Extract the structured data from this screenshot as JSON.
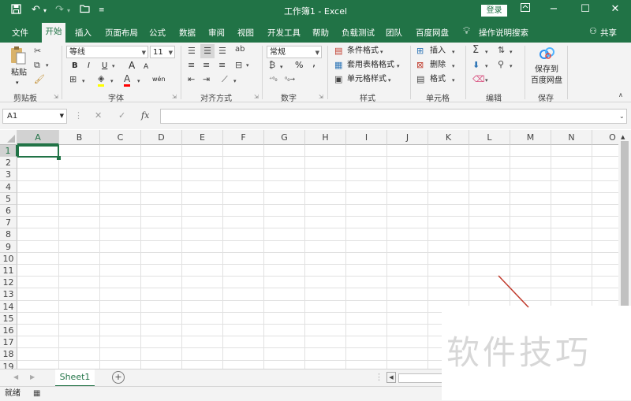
{
  "title_bar": {
    "title": "工作簿1 - Excel",
    "login_label": "登录",
    "quick_access": [
      "save-icon",
      "undo-icon",
      "redo-icon",
      "open-icon",
      "customize-icon"
    ],
    "window_controls": [
      "ribbon-display-icon",
      "minimize-icon",
      "maximize-icon",
      "close-icon"
    ]
  },
  "tabs": [
    "文件",
    "开始",
    "插入",
    "页面布局",
    "公式",
    "数据",
    "审阅",
    "视图",
    "开发工具",
    "帮助",
    "负载测试",
    "团队",
    "百度网盘"
  ],
  "tell_me": "操作说明搜索",
  "share": "共享",
  "ribbon": {
    "clipboard": {
      "paste_label": "粘贴",
      "group_label": "剪贴板"
    },
    "font": {
      "font_name": "等线",
      "font_size": "11",
      "group_label": "字体",
      "bold": "B",
      "italic": "I",
      "underline": "U",
      "phonetic": "wén",
      "grow": "A",
      "shrink": "A"
    },
    "alignment": {
      "group_label": "对齐方式"
    },
    "number": {
      "format": "常规",
      "percent": "%",
      "comma": ",",
      "group_label": "数字"
    },
    "styles": {
      "cond_format": "条件格式",
      "table_format": "套用表格格式",
      "cell_styles": "单元格样式",
      "group_label": "样式"
    },
    "cells": {
      "insert": "插入",
      "delete": "删除",
      "format": "格式",
      "group_label": "单元格"
    },
    "editing": {
      "group_label": "编辑"
    },
    "save": {
      "label_line1": "保存到",
      "label_line2": "百度网盘",
      "group_label": "保存"
    }
  },
  "formula_bar": {
    "name_box": "A1",
    "fx": "fx",
    "cancel": "✕",
    "enter": "✓",
    "formula": ""
  },
  "grid": {
    "columns": [
      "A",
      "B",
      "C",
      "D",
      "E",
      "F",
      "G",
      "H",
      "I",
      "J",
      "K",
      "L",
      "M",
      "N",
      "O"
    ],
    "rows": [
      "1",
      "2",
      "3",
      "4",
      "5",
      "6",
      "7",
      "8",
      "9",
      "10",
      "11",
      "12",
      "13",
      "14",
      "15",
      "16",
      "17",
      "18",
      "19"
    ],
    "selected_cell": "A1"
  },
  "sheets": {
    "tabs": [
      "Sheet1"
    ],
    "add": "+"
  },
  "status": {
    "ready": "就绪"
  },
  "watermark": "软件技巧",
  "colors": {
    "accent": "#217346",
    "ribbon_bg": "#f3f3f3"
  }
}
